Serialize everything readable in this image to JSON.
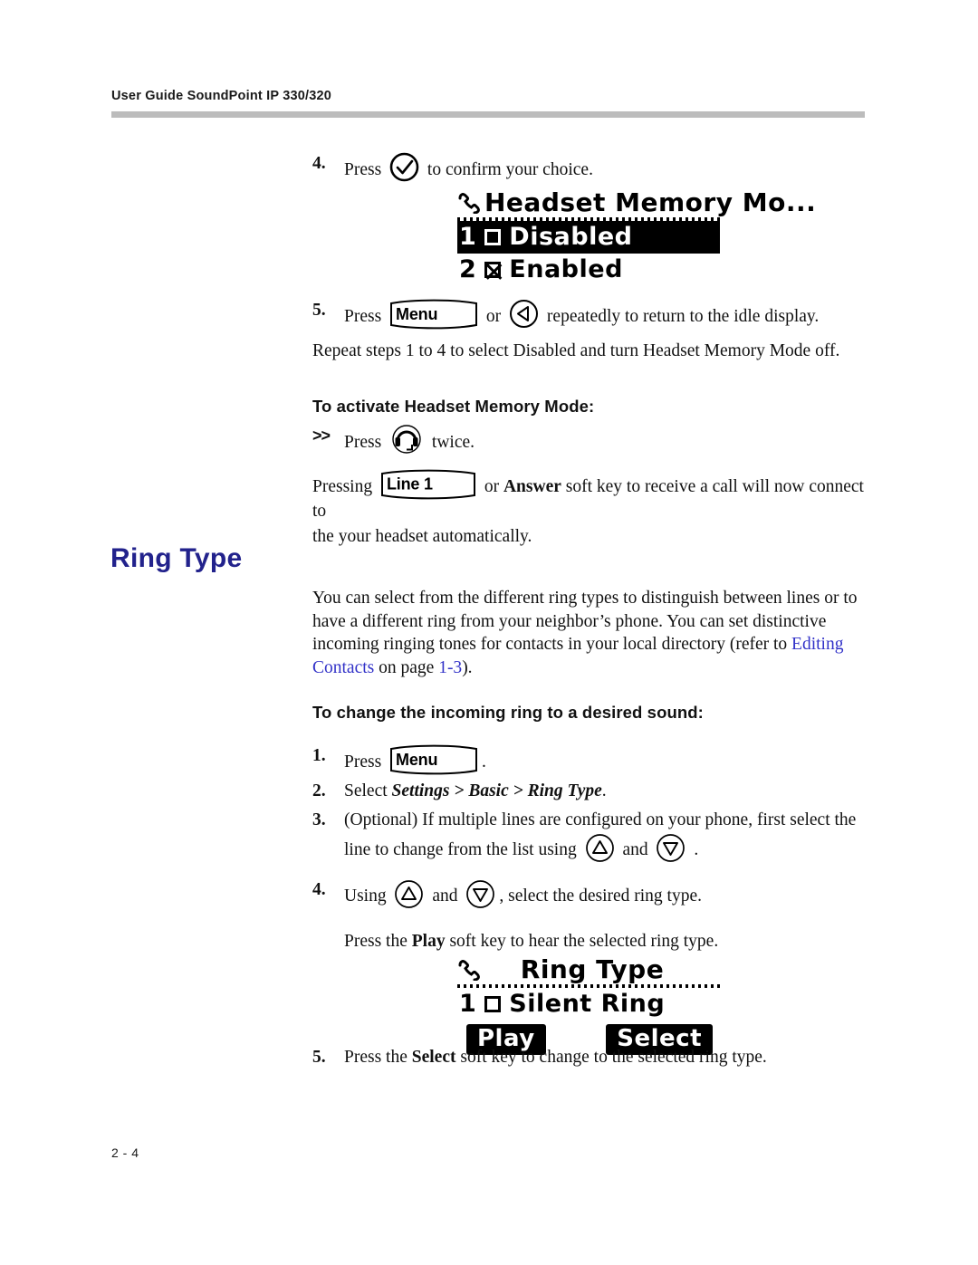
{
  "header": {
    "title": "User Guide SoundPoint IP 330/320"
  },
  "footer": {
    "page_number": "2 - 4"
  },
  "colors": {
    "heading_blue": "#22228c",
    "link_blue": "#3232c8",
    "rule_gray": "#bcbcbc"
  },
  "steps_top": {
    "step4": {
      "number": "4.",
      "before_icon": "Press",
      "icon": "checkmark-in-circle",
      "after_icon": "to confirm your choice."
    },
    "step5": {
      "number": "5.",
      "before_key": "Press",
      "key_label": "Menu",
      "between": "or",
      "icon": "left-arrow-in-circle",
      "after_icon": "repeatedly to return to the idle display."
    },
    "repeat_note": "Repeat steps 1 to 4 to select Disabled and turn Headset Memory Mode off."
  },
  "lcd_headset": {
    "title": "Headset Memory Mo...",
    "hook_icon": "phone-hook-icon",
    "items": [
      {
        "index": "1",
        "checkbox": "unchecked",
        "label": "Disabled",
        "selected": true
      },
      {
        "index": "2",
        "checkbox": "checked",
        "label": "Enabled",
        "selected": false
      }
    ]
  },
  "activate_section": {
    "heading": "To activate Headset Memory Mode:",
    "bullet_marker": ">>",
    "bullet_before": "Press",
    "bullet_icon": "headset-in-circle",
    "bullet_after": "twice.",
    "paragraph_part1": "Pressing",
    "paragraph_key": "Line 1",
    "paragraph_part2": "or",
    "paragraph_bold": "Answer",
    "paragraph_part3": "soft key to receive a call will now connect to",
    "paragraph_line2": "the your headset automatically."
  },
  "ring_type": {
    "heading": "Ring Type",
    "intro_line1": "You can select from the different ring types to distinguish between lines or to",
    "intro_line2": "have a different ring from your neighbor’s phone. You can set distinctive",
    "intro_line3_a": "incoming ringing tones for contacts in your local directory (refer to ",
    "intro_link1": "Editing",
    "intro_link2": "Contacts",
    "intro_line4_a": " on page ",
    "intro_link3": "1-3",
    "intro_line4_b": ")."
  },
  "change_ring_section": {
    "heading": "To change the incoming ring to a desired sound:",
    "step1": {
      "number": "1.",
      "before_key": "Press",
      "key_label": "Menu",
      "after_key": "."
    },
    "step2": {
      "number": "2.",
      "before": "Select ",
      "path": "Settings > Basic > Ring Type",
      "after": "."
    },
    "step3": {
      "number": "3.",
      "line1": "(Optional) If multiple lines are configured on your phone, first select the",
      "line2_a": "line to change from the list using",
      "icon_up": "up-arrow-in-circle",
      "line2_b": "and",
      "icon_down": "down-arrow-in-circle",
      "line2_c": "."
    },
    "step4": {
      "number": "4.",
      "line1_a": "Using",
      "icon_up": "up-arrow-in-circle",
      "line1_b": "and",
      "icon_down": "down-arrow-in-circle",
      "line1_c": ", select the desired ring type.",
      "line2_a": "Press the ",
      "line2_bold": "Play",
      "line2_b": " soft key to hear the selected ring type."
    },
    "step5": {
      "number": "5.",
      "before_bold": "Press the ",
      "bold": "Select",
      "after_bold": " soft key to change to the selected ring type."
    }
  },
  "lcd_ringtype": {
    "title": "Ring Type",
    "hook_icon": "phone-hook-icon",
    "items": [
      {
        "index": "1",
        "checkbox": "unchecked",
        "label": "Silent Ring",
        "selected": false
      }
    ],
    "softkey_left": "Play",
    "softkey_right": "Select"
  }
}
